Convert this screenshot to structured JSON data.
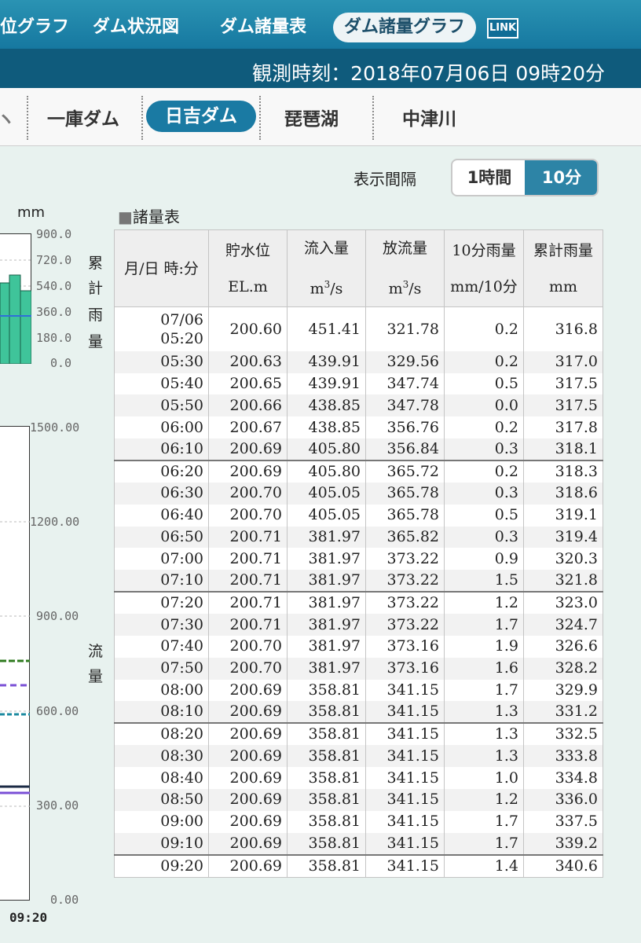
{
  "topnav": {
    "items": [
      "位グラフ",
      "ダム状況図",
      "ダム諸量表"
    ],
    "active": "ダム諸量グラフ",
    "link": "LINK"
  },
  "obs": {
    "time": "観測時刻：2018年07月06日 09時20分"
  },
  "dam_tabs": {
    "partial": "ヽ",
    "items": [
      "一庫ダム",
      "琵琶湖",
      "中津川"
    ],
    "active": "日吉ダム"
  },
  "interval": {
    "label": "表示間隔",
    "options": [
      "1時間",
      "10分"
    ],
    "selected": "10分"
  },
  "chart": {
    "rain_unit": "mm",
    "rain_ticks": [
      "900.0",
      "720.0",
      "540.0",
      "360.0",
      "180.0",
      "0.0"
    ],
    "rain_label": [
      "累",
      "計",
      "雨",
      "量"
    ],
    "flow_ticks": [
      "1500.00",
      "1200.00",
      "900.00",
      "600.00",
      "300.00",
      "0.00"
    ],
    "flow_label": [
      "流",
      "量"
    ],
    "time_label": "09:20",
    "colors": {
      "rain_bar": "#3fc49a",
      "cum_rain_line": "#2f6fd8",
      "inflow": "#2f7a1f",
      "outflow": "#7a4fd6",
      "level": "#1c8aa0"
    }
  },
  "table": {
    "title": "諸量表",
    "headers": {
      "time": "月/日 時:分",
      "level": "貯水位",
      "level_unit": "EL.m",
      "inflow": "流入量",
      "inflow_unit": "m",
      "outflow": "放流量",
      "outflow_unit": "m",
      "rain10": "10分雨量",
      "rain10_unit": "mm/10分",
      "cumrain": "累計雨量",
      "cumrain_unit": "mm",
      "unit_sup": "3",
      "unit_tail": "/s"
    },
    "rows": [
      {
        "date": "07/06",
        "time": "05:20",
        "level": "200.60",
        "inflow": "451.41",
        "outflow": "321.78",
        "rain": "0.2",
        "cum": "316.8"
      },
      {
        "time": "05:30",
        "level": "200.63",
        "inflow": "439.91",
        "outflow": "329.56",
        "rain": "0.2",
        "cum": "317.0"
      },
      {
        "time": "05:40",
        "level": "200.65",
        "inflow": "439.91",
        "outflow": "347.74",
        "rain": "0.5",
        "cum": "317.5"
      },
      {
        "time": "05:50",
        "level": "200.66",
        "inflow": "438.85",
        "outflow": "347.78",
        "rain": "0.0",
        "cum": "317.5"
      },
      {
        "time": "06:00",
        "level": "200.67",
        "inflow": "438.85",
        "outflow": "356.76",
        "rain": "0.2",
        "cum": "317.8"
      },
      {
        "time": "06:10",
        "level": "200.69",
        "inflow": "405.80",
        "outflow": "356.84",
        "rain": "0.3",
        "cum": "318.1"
      },
      {
        "time": "06:20",
        "level": "200.69",
        "inflow": "405.80",
        "outflow": "365.72",
        "rain": "0.2",
        "cum": "318.3"
      },
      {
        "time": "06:30",
        "level": "200.70",
        "inflow": "405.05",
        "outflow": "365.78",
        "rain": "0.3",
        "cum": "318.6"
      },
      {
        "time": "06:40",
        "level": "200.70",
        "inflow": "405.05",
        "outflow": "365.78",
        "rain": "0.5",
        "cum": "319.1"
      },
      {
        "time": "06:50",
        "level": "200.71",
        "inflow": "381.97",
        "outflow": "365.82",
        "rain": "0.3",
        "cum": "319.4"
      },
      {
        "time": "07:00",
        "level": "200.71",
        "inflow": "381.97",
        "outflow": "373.22",
        "rain": "0.9",
        "cum": "320.3"
      },
      {
        "time": "07:10",
        "level": "200.71",
        "inflow": "381.97",
        "outflow": "373.22",
        "rain": "1.5",
        "cum": "321.8"
      },
      {
        "time": "07:20",
        "level": "200.71",
        "inflow": "381.97",
        "outflow": "373.22",
        "rain": "1.2",
        "cum": "323.0"
      },
      {
        "time": "07:30",
        "level": "200.71",
        "inflow": "381.97",
        "outflow": "373.22",
        "rain": "1.7",
        "cum": "324.7"
      },
      {
        "time": "07:40",
        "level": "200.70",
        "inflow": "381.97",
        "outflow": "373.16",
        "rain": "1.9",
        "cum": "326.6"
      },
      {
        "time": "07:50",
        "level": "200.70",
        "inflow": "381.97",
        "outflow": "373.16",
        "rain": "1.6",
        "cum": "328.2"
      },
      {
        "time": "08:00",
        "level": "200.69",
        "inflow": "358.81",
        "outflow": "341.15",
        "rain": "1.7",
        "cum": "329.9"
      },
      {
        "time": "08:10",
        "level": "200.69",
        "inflow": "358.81",
        "outflow": "341.15",
        "rain": "1.3",
        "cum": "331.2"
      },
      {
        "time": "08:20",
        "level": "200.69",
        "inflow": "358.81",
        "outflow": "341.15",
        "rain": "1.3",
        "cum": "332.5"
      },
      {
        "time": "08:30",
        "level": "200.69",
        "inflow": "358.81",
        "outflow": "341.15",
        "rain": "1.3",
        "cum": "333.8"
      },
      {
        "time": "08:40",
        "level": "200.69",
        "inflow": "358.81",
        "outflow": "341.15",
        "rain": "1.0",
        "cum": "334.8"
      },
      {
        "time": "08:50",
        "level": "200.69",
        "inflow": "358.81",
        "outflow": "341.15",
        "rain": "1.2",
        "cum": "336.0"
      },
      {
        "time": "09:00",
        "level": "200.69",
        "inflow": "358.81",
        "outflow": "341.15",
        "rain": "1.7",
        "cum": "337.5"
      },
      {
        "time": "09:10",
        "level": "200.69",
        "inflow": "358.81",
        "outflow": "341.15",
        "rain": "1.7",
        "cum": "339.2"
      },
      {
        "time": "09:20",
        "level": "200.69",
        "inflow": "358.81",
        "outflow": "341.15",
        "rain": "1.4",
        "cum": "340.6"
      }
    ]
  }
}
